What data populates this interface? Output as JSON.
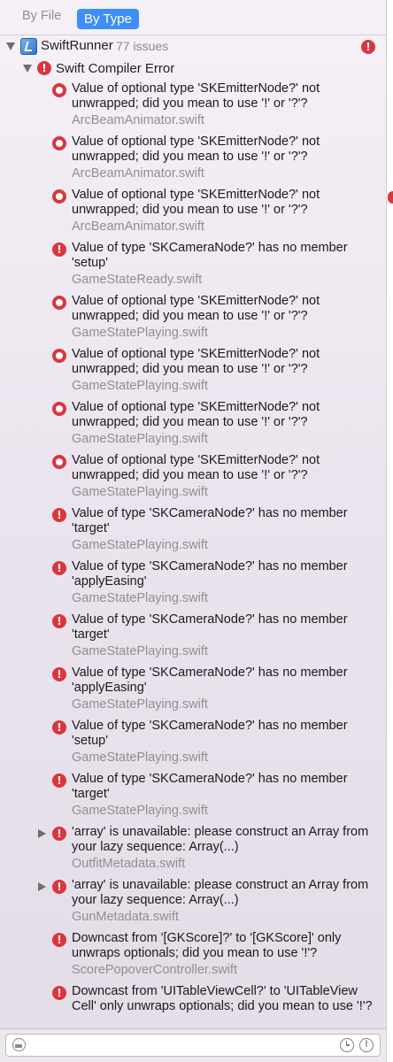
{
  "toolbar": {
    "by_file_label": "By File",
    "by_type_label": "By Type"
  },
  "project": {
    "name": "SwiftRunner",
    "issue_count": "77 issues"
  },
  "category": {
    "name": "Swift Compiler Error"
  },
  "issues": [
    {
      "icon": "optional-error-icon",
      "message": "Value of optional type 'SKEmitterNode?' not unwrapped; did you mean to use '!' or '?'?",
      "file": "ArcBeamAnimator.swift"
    },
    {
      "icon": "optional-error-icon",
      "message": "Value of optional type 'SKEmitterNode?' not unwrapped; did you mean to use '!' or '?'?",
      "file": "ArcBeamAnimator.swift"
    },
    {
      "icon": "optional-error-icon",
      "message": "Value of optional type 'SKEmitterNode?' not unwrapped; did you mean to use '!' or '?'?",
      "file": "ArcBeamAnimator.swift"
    },
    {
      "icon": "error-icon",
      "message": "Value of type 'SKCameraNode?' has no member 'setup'",
      "file": "GameStateReady.swift"
    },
    {
      "icon": "optional-error-icon",
      "message": "Value of optional type 'SKEmitterNode?' not unwrapped; did you mean to use '!' or '?'?",
      "file": "GameStatePlaying.swift"
    },
    {
      "icon": "optional-error-icon",
      "message": "Value of optional type 'SKEmitterNode?' not unwrapped; did you mean to use '!' or '?'?",
      "file": "GameStatePlaying.swift"
    },
    {
      "icon": "optional-error-icon",
      "message": "Value of optional type 'SKEmitterNode?' not unwrapped; did you mean to use '!' or '?'?",
      "file": "GameStatePlaying.swift"
    },
    {
      "icon": "optional-error-icon",
      "message": "Value of optional type 'SKEmitterNode?' not unwrapped; did you mean to use '!' or '?'?",
      "file": "GameStatePlaying.swift"
    },
    {
      "icon": "error-icon",
      "message": "Value of type 'SKCameraNode?' has no member 'target'",
      "file": "GameStatePlaying.swift"
    },
    {
      "icon": "error-icon",
      "message": "Value of type 'SKCameraNode?' has no member 'applyEasing'",
      "file": "GameStatePlaying.swift"
    },
    {
      "icon": "error-icon",
      "message": "Value of type 'SKCameraNode?' has no member 'target'",
      "file": "GameStatePlaying.swift"
    },
    {
      "icon": "error-icon",
      "message": "Value of type 'SKCameraNode?' has no member 'applyEasing'",
      "file": "GameStatePlaying.swift"
    },
    {
      "icon": "error-icon",
      "message": "Value of type 'SKCameraNode?' has no member 'setup'",
      "file": "GameStatePlaying.swift"
    },
    {
      "icon": "error-icon",
      "message": "Value of type 'SKCameraNode?' has no member 'target'",
      "file": "GameStatePlaying.swift"
    },
    {
      "icon": "error-icon",
      "message": "'array' is unavailable: please construct an Array from your lazy sequence: Array(...)",
      "file": "OutfitMetadata.swift",
      "expandable": true
    },
    {
      "icon": "error-icon",
      "message": "'array' is unavailable: please construct an Array from your lazy sequence: Array(...)",
      "file": "GunMetadata.swift",
      "expandable": true
    },
    {
      "icon": "error-icon",
      "message": "Downcast from '[GKScore]?' to '[GKScore]' only unwraps optionals; did you mean to use '!'?",
      "file": "ScorePopoverController.swift"
    },
    {
      "icon": "error-icon",
      "message": "Downcast from 'UITableViewCell?' to 'UITableView Cell' only unwraps optionals; did you mean to use '!'?",
      "file": ""
    }
  ],
  "filter": {
    "value": "",
    "placeholder": ""
  },
  "colors": {
    "accent": "#3d8ef5",
    "error": "#d9363e"
  }
}
